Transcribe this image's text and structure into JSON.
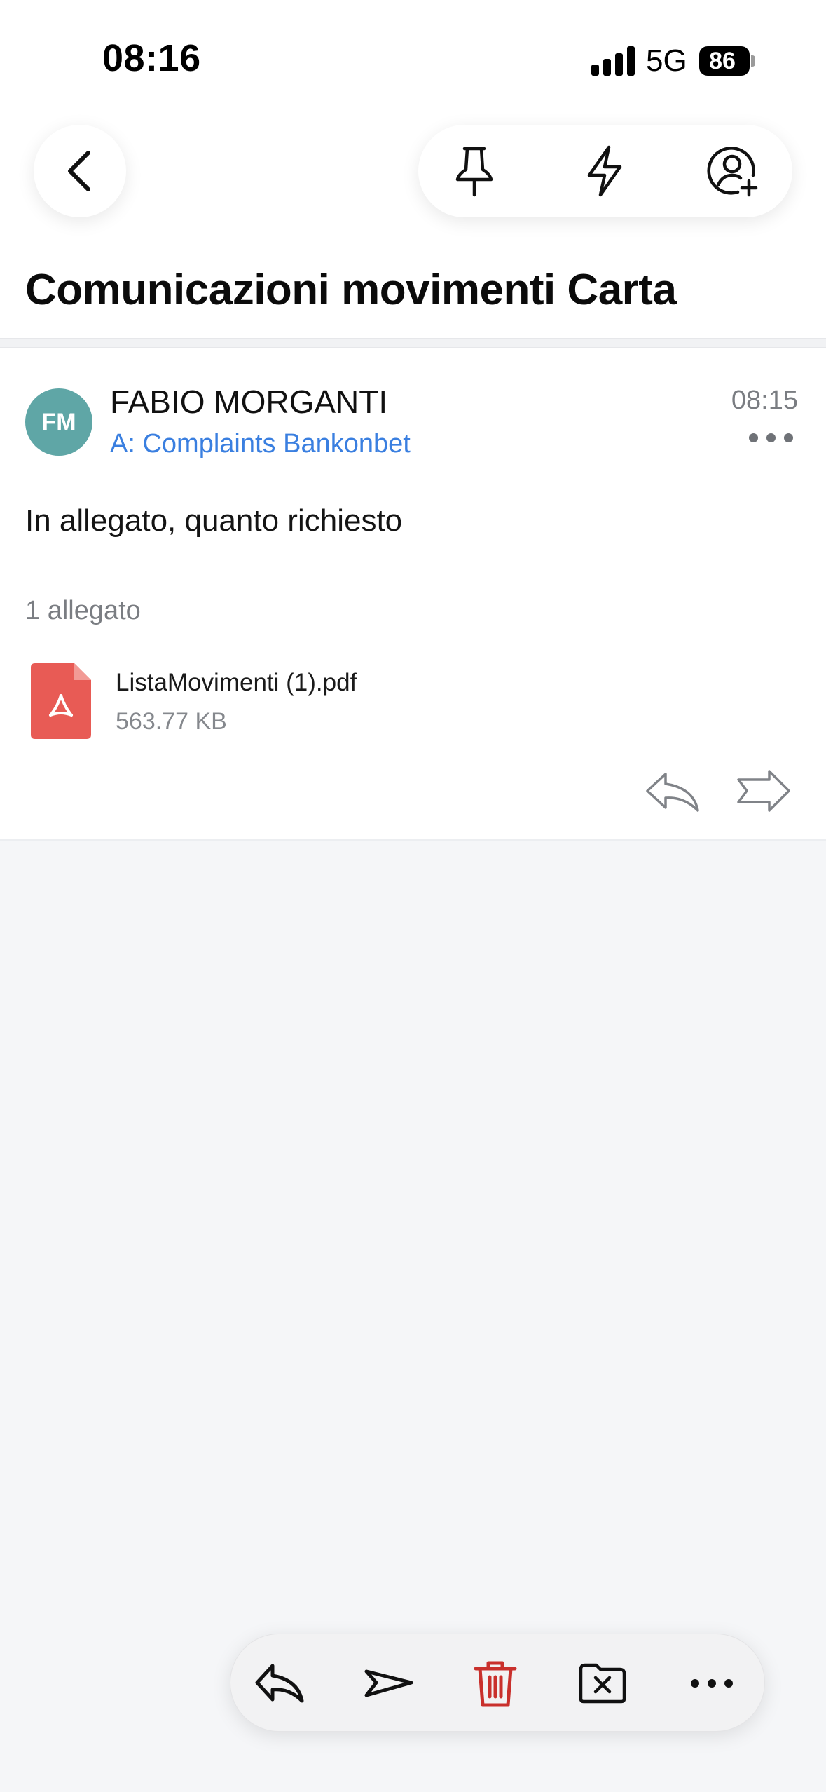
{
  "status_bar": {
    "time": "08:16",
    "network": "5G",
    "battery": "86"
  },
  "toolbar": {
    "icons": [
      "back-icon",
      "pin-icon",
      "lightning-icon",
      "add-contact-icon"
    ]
  },
  "email": {
    "subject": "Comunicazioni movimenti Carta",
    "avatar_initials": "FM",
    "avatar_color": "#5fa6a6",
    "sender": "FABIO MORGANTI",
    "recipient": "A: Complaints Bankonbet",
    "time": "08:15",
    "body": "In allegato, quanto richiesto",
    "attachments_count": "1 allegato",
    "attachment": {
      "name": "ListaMovimenti (1).pdf",
      "size": "563.77 KB",
      "icon_color": "#e85b55"
    }
  },
  "bottom_bar": {
    "icons": [
      "reply-icon",
      "forward-icon",
      "trash-icon",
      "archive-icon",
      "more-icon"
    ],
    "trash_color": "#c9302c"
  },
  "colors": {
    "link": "#3a7fe0",
    "background": "#f5f6f8"
  }
}
